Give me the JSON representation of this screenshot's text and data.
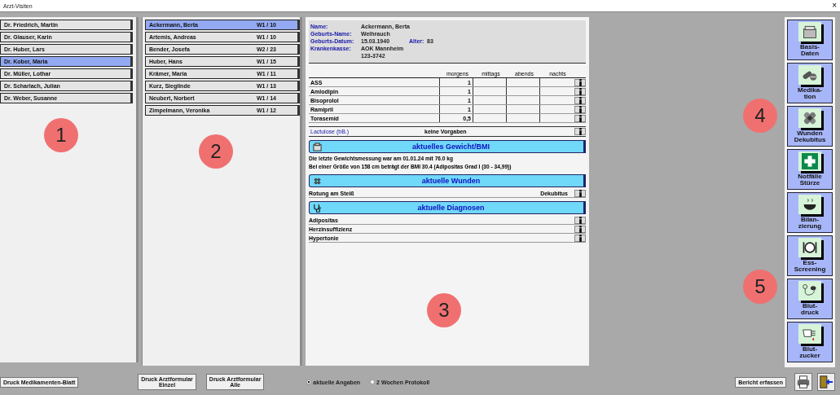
{
  "window": {
    "title": "Arzt-Visiten",
    "close": "×"
  },
  "doctors": [
    {
      "name": "Dr. Friedrich, Martin",
      "selected": false
    },
    {
      "name": "Dr. Glauser, Karin",
      "selected": false
    },
    {
      "name": "Dr. Huber, Lars",
      "selected": false
    },
    {
      "name": "Dr. Kober, Maria",
      "selected": true
    },
    {
      "name": "Dr. Müller, Lothar",
      "selected": false
    },
    {
      "name": "Dr. Scharlach, Julian",
      "selected": false
    },
    {
      "name": "Dr. Weber, Susanne",
      "selected": false
    }
  ],
  "patients": [
    {
      "name": "Ackermann, Berta",
      "room": "W1 / 10",
      "selected": true
    },
    {
      "name": "Artemis, Andreas",
      "room": "W1 / 10",
      "selected": false
    },
    {
      "name": "Bender, Josefa",
      "room": "W2 / 23",
      "selected": false
    },
    {
      "name": "Huber, Hans",
      "room": "W1 / 15",
      "selected": false
    },
    {
      "name": "Krämer, Maria",
      "room": "W1 / 11",
      "selected": false
    },
    {
      "name": "Kurz, Sieglinde",
      "room": "W1 / 13",
      "selected": false
    },
    {
      "name": "Neubert, Norbert",
      "room": "W1 / 14",
      "selected": false
    },
    {
      "name": "Zimpelmann, Veronika",
      "room": "W1 / 12",
      "selected": false
    }
  ],
  "patient_info": {
    "fields": [
      {
        "label": "Name:",
        "value": "Ackermann, Berta"
      },
      {
        "label": "Geburts-Name:",
        "value": "Weihrauch"
      },
      {
        "label": "Geburts-Datum:",
        "value": "15.03.1940",
        "extra_label": "Alter:",
        "extra_value": "83"
      },
      {
        "label": "Krankenkasse:",
        "value": "AOK Mannheim"
      }
    ],
    "insurance_number": "123-3742"
  },
  "medication": {
    "columns": [
      "morgens",
      "mittags",
      "abends",
      "nachts"
    ],
    "rows": [
      {
        "name": "ASS",
        "morgens": "1"
      },
      {
        "name": "Amlodipin",
        "morgens": "1"
      },
      {
        "name": "Bisoprolol",
        "morgens": "1"
      },
      {
        "name": "Ramipril",
        "morgens": "1"
      },
      {
        "name": "Torasemid",
        "morgens": "0,5"
      }
    ],
    "as_needed": [
      {
        "name": "Lactulose (bB.)",
        "note": "keine Vorgaben"
      }
    ]
  },
  "sections": [
    {
      "kind": "weight",
      "title": "aktuelles Gewicht/BMI",
      "lines": [
        "Die letzte Gewichtsmessung war am 01.01.24 mit 76.0 kg",
        "Bei einer Größe von 158 cm beträgt der BMI 30.4 (Adipositas Grad I (30 - 34,99))"
      ]
    },
    {
      "kind": "wounds",
      "title": "aktuelle Wunden",
      "items": [
        {
          "name": "Rotung am Steiß",
          "type": "Dekubitus"
        }
      ]
    },
    {
      "kind": "diagnoses",
      "title": "aktuelle Diagnosen",
      "items": [
        {
          "name": "Adipositas"
        },
        {
          "name": "Herzinsuffizienz"
        },
        {
          "name": "Hypertonie"
        }
      ]
    }
  ],
  "sidebar": [
    {
      "kind": "basis",
      "label": "Basis-\nDaten"
    },
    {
      "kind": "pills",
      "label": "Medika-\ntion"
    },
    {
      "kind": "bandage",
      "label": "Wunden\nDekubitus"
    },
    {
      "kind": "firstaid",
      "label": "Notfälle\nStürze"
    },
    {
      "kind": "bowl",
      "label": "Bilan-\nzierung"
    },
    {
      "kind": "plate",
      "label": "Ess-\nScreening"
    },
    {
      "kind": "pressure",
      "label": "Blut-\ndruck"
    },
    {
      "kind": "sugar",
      "label": "Blut-\nzucker"
    }
  ],
  "bottom": {
    "print_meds": "Druck Medikamenten-Blatt",
    "print_single": "Druck Arztformular\nEinzel",
    "print_all": "Druck Arztformular\nAlle",
    "options": [
      {
        "label": "aktuelle Angaben",
        "selected": true
      },
      {
        "label": "2 Wochen Protokoll",
        "selected": false
      }
    ],
    "report": "Bericht erfassen"
  },
  "annotations": [
    {
      "label": "1",
      "kind": "doctors"
    },
    {
      "label": "2",
      "kind": "patients"
    },
    {
      "label": "3",
      "kind": "details"
    },
    {
      "label": "4",
      "kind": "side_top"
    },
    {
      "label": "5",
      "kind": "side_bottom"
    }
  ]
}
